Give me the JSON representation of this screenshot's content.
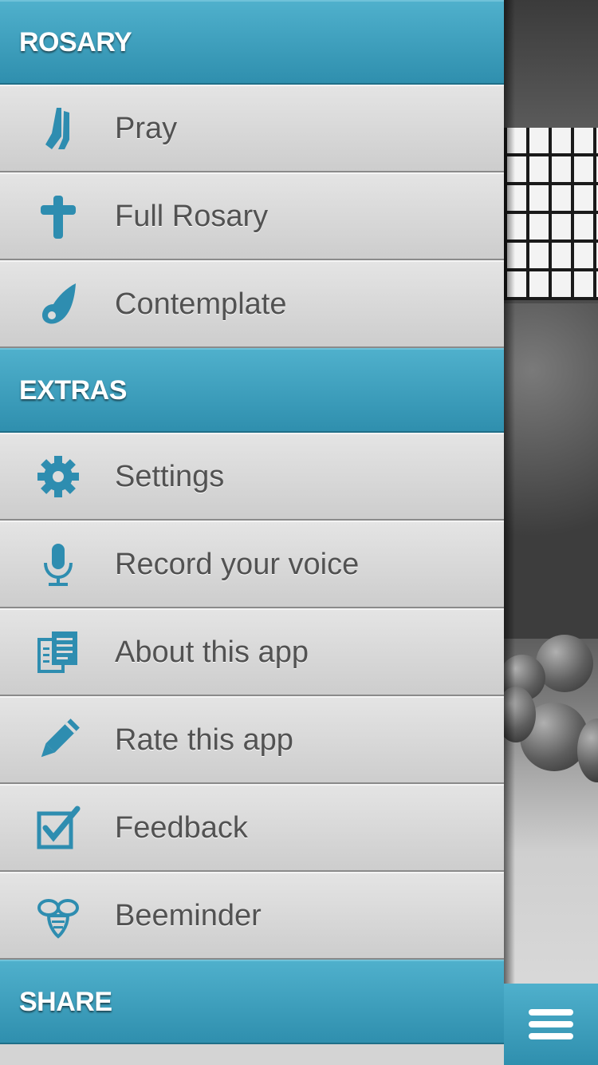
{
  "sections": [
    {
      "title": "ROSARY",
      "items": [
        {
          "label": "Pray",
          "icon": "praying-hands-icon"
        },
        {
          "label": "Full Rosary",
          "icon": "cross-icon"
        },
        {
          "label": "Contemplate",
          "icon": "wing-icon"
        }
      ]
    },
    {
      "title": "EXTRAS",
      "items": [
        {
          "label": "Settings",
          "icon": "gear-icon"
        },
        {
          "label": "Record your voice",
          "icon": "microphone-icon"
        },
        {
          "label": "About this app",
          "icon": "document-icon"
        },
        {
          "label": "Rate this app",
          "icon": "pencil-icon"
        },
        {
          "label": "Feedback",
          "icon": "checkbox-icon"
        },
        {
          "label": "Beeminder",
          "icon": "bee-icon"
        }
      ]
    },
    {
      "title": "SHARE",
      "items": []
    }
  ],
  "colors": {
    "accent": "#3a9bbb",
    "header_text": "#ffffff",
    "item_text": "#525252",
    "item_bg": "#dcdcdc"
  },
  "menu_button": {
    "icon": "hamburger-menu-icon"
  }
}
